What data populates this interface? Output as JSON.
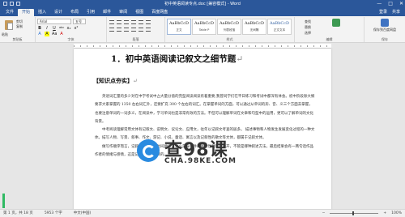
{
  "window": {
    "title": "初中英语阅读专点.doc [兼容模式] - Word",
    "controls": [
      "—",
      "□",
      "✕"
    ]
  },
  "tabs": [
    "文件",
    "开始",
    "插入",
    "设计",
    "布局",
    "引用",
    "邮件",
    "审阅",
    "视图",
    "百度网盘"
  ],
  "tabs_right": [
    "登录",
    "共享"
  ],
  "ribbon": {
    "paste_label": "粘贴",
    "clipboard_small": [
      "剪切",
      "复制"
    ],
    "font_name": "Arial",
    "font_size": "五号",
    "format_buttons": [
      "B",
      "I",
      "U",
      "abc",
      "x₂",
      "x²"
    ],
    "format_buttons2": [
      "A",
      "A",
      "Aa",
      "A"
    ],
    "styles": [
      {
        "preview": "AaBbCcD",
        "name": "正文"
      },
      {
        "preview": "AaBbCcD",
        "name": "Table P"
      },
      {
        "preview": "AaBbCcD",
        "name": "列表段落"
      },
      {
        "preview": "AaBbCcD",
        "name": "无间隔"
      },
      {
        "preview": "AaBbCcD",
        "name": "正文文本"
      }
    ],
    "edit_items": [
      "查找",
      "替换",
      "选择"
    ],
    "save_label": "保存到百度网盘",
    "group_labels": [
      "剪贴板",
      "字体",
      "段落",
      "样式",
      "编辑",
      "保存"
    ]
  },
  "document": {
    "heading": "1．初中英语阅读记叙文之细节题",
    "section_title": "【知识点夯实】",
    "paragraphs": [
      "英语词汇量的多少对在中学考试中占大量分值的完型阅读阅读有着重要,我曾同学们在平日练习和考试中都深有体会。初中阶段除大纲要求大家掌握的 1350 左右词汇外，还要扩充 300 个左右的词汇。在掌握单词的方面，可以通过从单词的形、音、义三个方面去掌握，也要注意单词的一词多义，在阅读中，学习单词也是非常有效的方法。不但可以理解单词在文章和句型中的运用，更可以了解单词的文化背景。",
      "中考阅读理解常用文体有记叙文、说明文、议论文、应用文，往年以记叙文考查的居多。    描述事物和人物发生发展变化过程的一种文体。描写人物、写景、叙事、作文、游记、小说、童话、寓言以及记叙性的散文等文体，都属于记叙文体。",
      "做写作顺序而言，记叙文要么是按时间顺序，要么是按事件的重要性顺序来展开，不管是哪种叙述方法，最后结果会有一两句话作品作者的情绪与感情，这是记叙文的最终目的。"
    ]
  },
  "watermark": {
    "big": "查98课",
    "url": "CHA.98KE.COM"
  },
  "status": {
    "page": "第 1 页，共 18 页",
    "words": "5953 个字",
    "lang": "中文(中国)",
    "zoom": "100%"
  }
}
